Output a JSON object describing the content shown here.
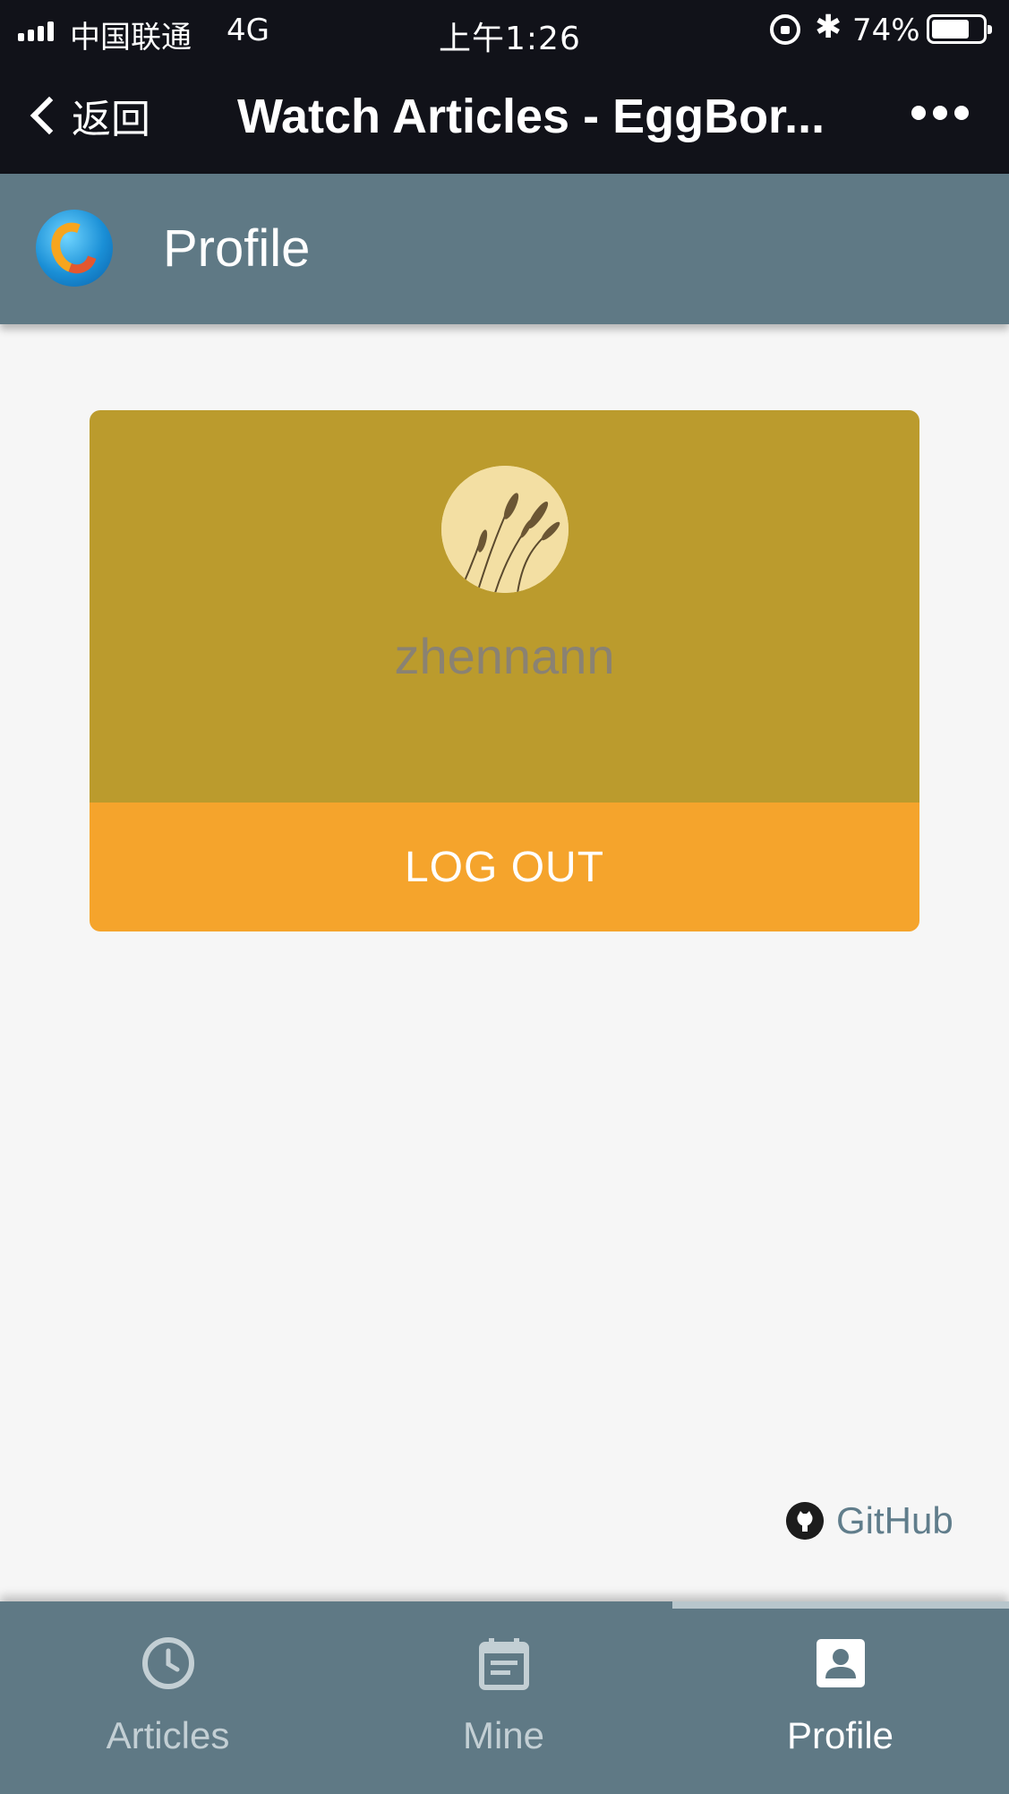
{
  "status_bar": {
    "carrier": "中国联通",
    "network": "4G",
    "time": "上午1:26",
    "battery": "74%",
    "battery_level": 0.74
  },
  "nav_bar": {
    "back_label": "返回",
    "title": "Watch Articles - EggBor..."
  },
  "header": {
    "title": "Profile"
  },
  "profile": {
    "username": "zhennann",
    "logout_label": "LOG OUT"
  },
  "footer": {
    "github_label": "GitHub"
  },
  "tabs": [
    {
      "label": "Articles",
      "icon": "clock-icon",
      "active": false
    },
    {
      "label": "Mine",
      "icon": "calendar-icon",
      "active": false
    },
    {
      "label": "Profile",
      "icon": "account-box-icon",
      "active": true
    }
  ],
  "colors": {
    "status_bg": "#111219",
    "header_bg": "#5f7985",
    "card_bg": "#bb9b2d",
    "logout_bg": "#f5a42c",
    "page_bg": "#f6f6f6",
    "github_text": "#607d8b"
  }
}
